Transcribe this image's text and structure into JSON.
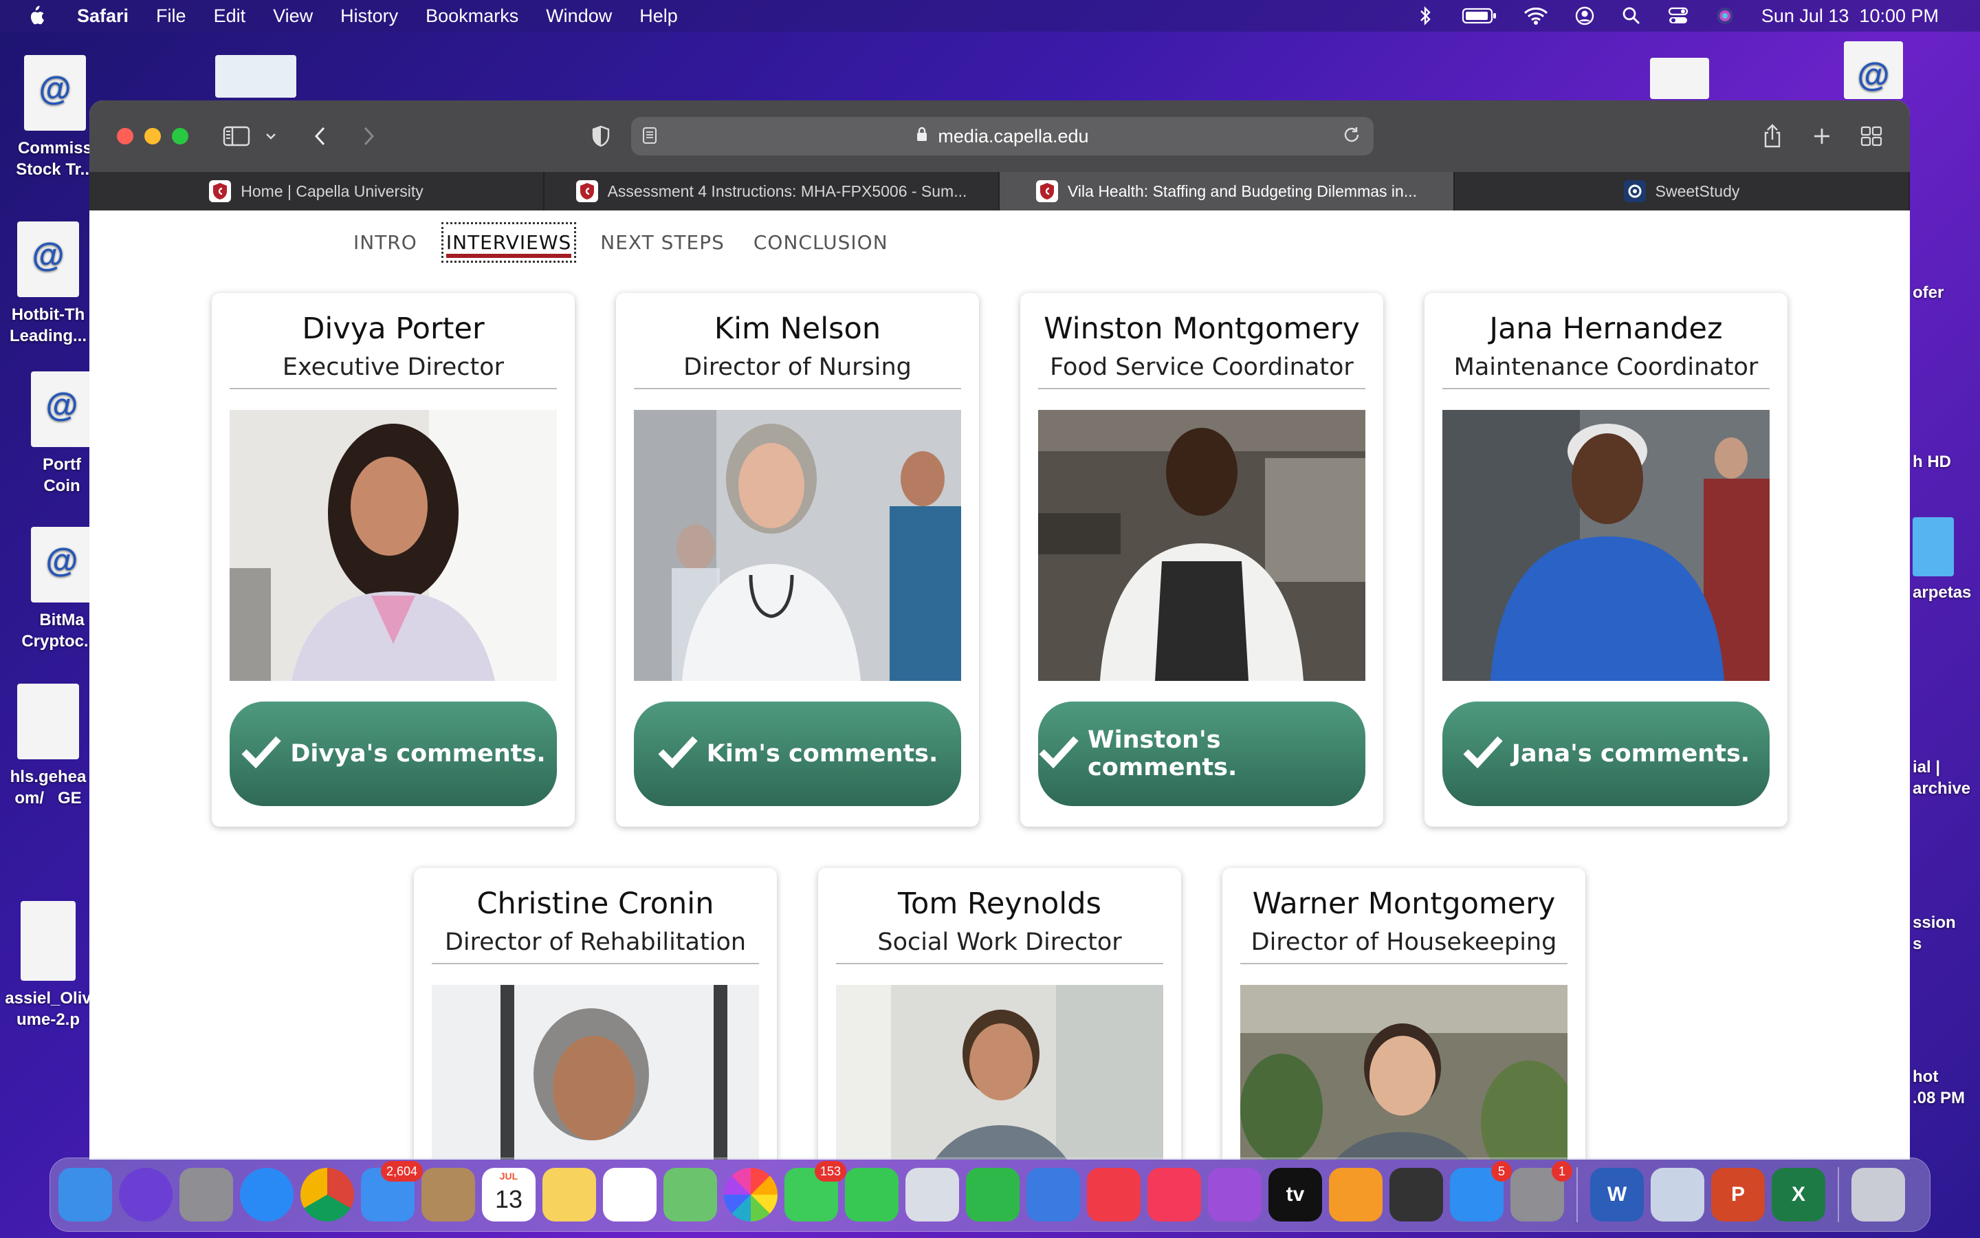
{
  "menubar": {
    "app": "Safari",
    "items": [
      "File",
      "Edit",
      "View",
      "History",
      "Bookmarks",
      "Window",
      "Help"
    ],
    "clock": "Sun Jul 13  10:00 PM"
  },
  "desktop": {
    "left_icons": [
      {
        "label": "Commiss\nStock Tr..."
      },
      {
        "label": "Hotbit-Th\nLeading..."
      },
      {
        "label": "Portf\nCoin"
      },
      {
        "label": "BitMa\nCryptoc...i"
      },
      {
        "label": "hls.gehea\nom/   GE"
      },
      {
        "label": "assiel_Oliv\nume-2.p"
      }
    ],
    "right_icons": [
      {
        "label": "ofer"
      },
      {
        "label": "h HD"
      },
      {
        "label": "arpetas"
      },
      {
        "label": "ial |\narchive"
      },
      {
        "label": "ssion\ns"
      },
      {
        "label": "hot\n.08 PM"
      }
    ]
  },
  "browser": {
    "url": "media.capella.edu",
    "tabs": [
      {
        "title": "Home | Capella University",
        "active": false
      },
      {
        "title": "Assessment 4 Instructions: MHA-FPX5006 - Sum...",
        "active": false
      },
      {
        "title": "Vila Health: Staffing and Budgeting Dilemmas in...",
        "active": true
      },
      {
        "title": "SweetStudy",
        "active": false
      }
    ]
  },
  "page": {
    "nav": [
      {
        "label": "INTRO",
        "active": false
      },
      {
        "label": "INTERVIEWS",
        "active": true
      },
      {
        "label": "NEXT STEPS",
        "active": false
      },
      {
        "label": "CONCLUSION",
        "active": false
      }
    ],
    "cards": [
      {
        "name": "Divya Porter",
        "title": "Executive Director",
        "button": "Divya's comments."
      },
      {
        "name": "Kim Nelson",
        "title": "Director of Nursing",
        "button": "Kim's comments."
      },
      {
        "name": "Winston Montgomery",
        "title": "Food Service Coordinator",
        "button": "Winston's comments."
      },
      {
        "name": "Jana Hernandez",
        "title": "Maintenance Coordinator",
        "button": "Jana's comments."
      },
      {
        "name": "Christine Cronin",
        "title": "Director of Rehabilitation",
        "button": ""
      },
      {
        "name": "Tom Reynolds",
        "title": "Social Work Director",
        "button": ""
      },
      {
        "name": "Warner Montgomery",
        "title": "Director of Housekeeping",
        "button": ""
      }
    ]
  },
  "dock": {
    "apps": [
      {
        "name": "Finder",
        "icon": "finder-icon",
        "color": "#3b8fe8"
      },
      {
        "name": "Siri",
        "icon": "siri-icon",
        "color": "#6b3fd4"
      },
      {
        "name": "Launchpad",
        "icon": "launchpad-icon",
        "color": "#8e8e93"
      },
      {
        "name": "Safari",
        "icon": "safari-icon",
        "color": "#2a8af5"
      },
      {
        "name": "Chrome",
        "icon": "chrome-icon",
        "color": "#f1f1f1"
      },
      {
        "name": "Mail",
        "icon": "mail-icon",
        "color": "#3d8ff0",
        "badge": "2,604"
      },
      {
        "name": "Contacts",
        "icon": "contacts-icon",
        "color": "#b08a5a"
      },
      {
        "name": "Calendar",
        "icon": "calendar-icon",
        "color": "#ffffff",
        "text": "13",
        "subtext": "JUL"
      },
      {
        "name": "Notes",
        "icon": "notes-icon",
        "color": "#f7d25c"
      },
      {
        "name": "Reminders",
        "icon": "reminders-icon",
        "color": "#ffffff"
      },
      {
        "name": "Maps",
        "icon": "maps-icon",
        "color": "#6cc36e"
      },
      {
        "name": "Photos",
        "icon": "photos-icon",
        "color": "#ffffff"
      },
      {
        "name": "Messages",
        "icon": "messages-icon",
        "color": "#3dcb5a",
        "badge": "153"
      },
      {
        "name": "FaceTime",
        "icon": "facetime-icon",
        "color": "#37c854"
      },
      {
        "name": "Preview",
        "icon": "preview-icon",
        "color": "#d9dde5"
      },
      {
        "name": "Numbers",
        "icon": "numbers-icon",
        "color": "#2fb84a"
      },
      {
        "name": "Keynote",
        "icon": "keynote-icon",
        "color": "#3b7ae0"
      },
      {
        "name": "News",
        "icon": "news-icon",
        "color": "#f03a48"
      },
      {
        "name": "Music",
        "icon": "music-icon",
        "color": "#f5395a"
      },
      {
        "name": "Podcasts",
        "icon": "podcasts-icon",
        "color": "#9b4ed8"
      },
      {
        "name": "TV",
        "icon": "tv-icon",
        "color": "#111111",
        "text": "tv"
      },
      {
        "name": "Books",
        "icon": "books-icon",
        "color": "#f59a26"
      },
      {
        "name": "Screen",
        "icon": "device-icon",
        "color": "#333333"
      },
      {
        "name": "App Store",
        "icon": "appstore-icon",
        "color": "#2e8ef2",
        "badge": "5"
      },
      {
        "name": "System Settings",
        "icon": "settings-icon",
        "color": "#8e8e93",
        "badge": "1"
      },
      {
        "name": "Word",
        "icon": "word-icon",
        "color": "#2b5db9",
        "text": "W"
      },
      {
        "name": "Preview2",
        "icon": "photo-viewer-icon",
        "color": "#c8d4e6"
      },
      {
        "name": "PowerPoint",
        "icon": "powerpoint-icon",
        "color": "#d24726",
        "text": "P"
      },
      {
        "name": "Excel",
        "icon": "excel-icon",
        "color": "#1e7a45",
        "text": "X"
      },
      {
        "name": "Trash",
        "icon": "trash-icon",
        "color": "#c9ccd4"
      }
    ]
  }
}
